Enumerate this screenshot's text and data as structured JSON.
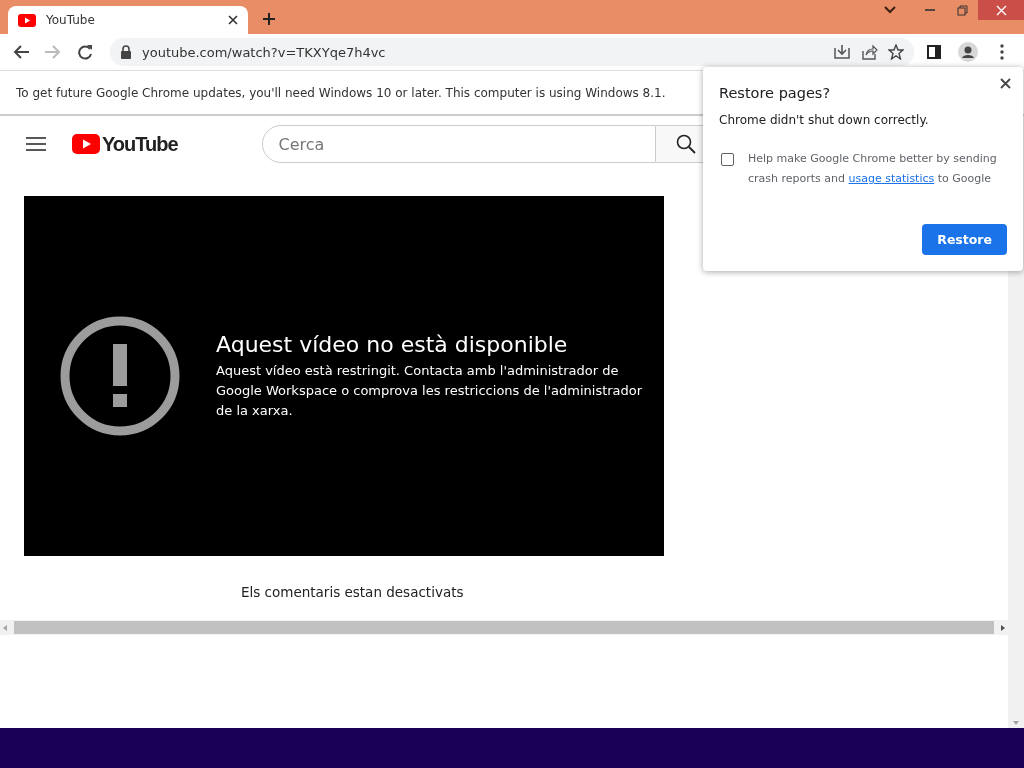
{
  "window": {
    "tabs": [
      {
        "title": "YouTube",
        "selected": true
      }
    ]
  },
  "toolbar": {
    "nav": [
      {
        "kind": "back",
        "disabled": false
      },
      {
        "kind": "forward",
        "disabled": true
      },
      {
        "kind": "reload",
        "disabled": false
      }
    ],
    "url": "youtube.com/watch?v=TKXYqe7h4vc"
  },
  "infobar": {
    "message": "To get future Google Chrome updates, you'll need Windows 10 or later. This computer is using Windows 8.1."
  },
  "page": {
    "logo": "YouTube",
    "search": {
      "placeholder": "Cerca"
    },
    "player": {
      "title": "Aquest vídeo no està disponible",
      "message": "Aquest vídeo està restringit. Contacta amb l'administrador de Google Workspace o comprova les restriccions de l'administrador de la xarxa."
    },
    "comments": "Els comentaris estan desactivats"
  },
  "dialog": {
    "title": "Restore pages?",
    "message": "Chrome didn't shut down correctly.",
    "checkbox": {
      "checked": false,
      "text_before": "Help make Google Chrome better by sending crash reports and",
      "link": "usage statistics",
      "text_after": "to Google"
    },
    "button": "Restore"
  }
}
